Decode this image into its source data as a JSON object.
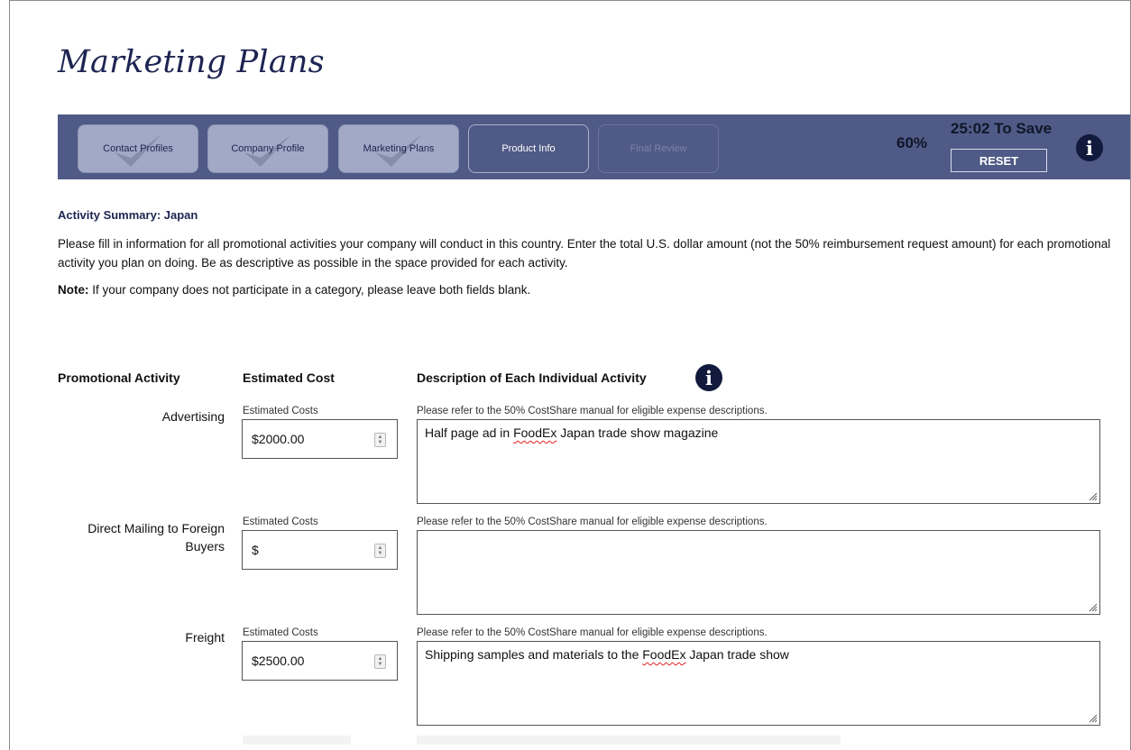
{
  "page": {
    "title": "Marketing Plans"
  },
  "nav": {
    "steps": [
      {
        "label": "Contact Profiles",
        "state": "done"
      },
      {
        "label": "Company Profile",
        "state": "done"
      },
      {
        "label": "Marketing Plans",
        "state": "done"
      },
      {
        "label": "Product Info",
        "state": "current"
      },
      {
        "label": "Final Review",
        "state": "future"
      }
    ],
    "progress": "60%",
    "timer": "25:02 To Save",
    "reset_label": "RESET",
    "info_icon": "i"
  },
  "summary": {
    "title": "Activity Summary: Japan",
    "intro": "Please fill in information for all promotional activities your company will conduct in this country. Enter the total U.S. dollar amount (not the 50% reimbursement request amount) for each promotional activity you plan on doing. Be as descriptive as possible in the space provided for each activity.",
    "note_label": "Note:",
    "note_text": " If your company does not participate in a category, please leave both fields blank."
  },
  "columns": {
    "activity": "Promotional Activity",
    "cost": "Estimated Cost",
    "description": "Description of Each Individual Activity"
  },
  "activities": [
    {
      "label": "Advertising",
      "cost_caption": "Estimated Costs",
      "cost_value": "$2000.00",
      "desc_caption": "Please refer to the 50% CostShare manual for eligible expense descriptions.",
      "desc_before": "Half page ad in ",
      "desc_flag": "FoodEx",
      "desc_after": " Japan trade show magazine"
    },
    {
      "label": "Direct Mailing to Foreign Buyers",
      "cost_caption": "Estimated Costs",
      "cost_value": "$",
      "desc_caption": "Please refer to the 50% CostShare manual for eligible expense descriptions.",
      "desc_before": "",
      "desc_flag": "",
      "desc_after": ""
    },
    {
      "label": "Freight",
      "cost_caption": "Estimated Costs",
      "cost_value": "$2500.00",
      "desc_caption": "Please refer to the 50% CostShare manual for eligible expense descriptions.",
      "desc_before": "Shipping samples and materials to the ",
      "desc_flag": "FoodEx",
      "desc_after": " Japan trade show"
    }
  ],
  "colors": {
    "nav_bg": "#4f5a86",
    "step_done_bg": "#a1a9c6",
    "title_color": "#1e2452",
    "info_bg": "#111a3c"
  }
}
